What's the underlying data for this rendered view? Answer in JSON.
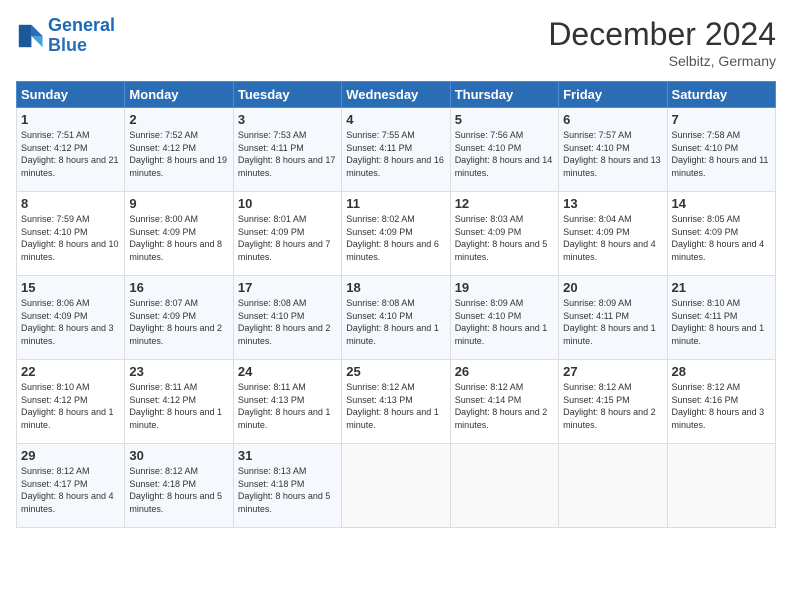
{
  "header": {
    "logo_line1": "General",
    "logo_line2": "Blue",
    "month": "December 2024",
    "location": "Selbitz, Germany"
  },
  "weekdays": [
    "Sunday",
    "Monday",
    "Tuesday",
    "Wednesday",
    "Thursday",
    "Friday",
    "Saturday"
  ],
  "weeks": [
    [
      {
        "day": "1",
        "sunrise": "Sunrise: 7:51 AM",
        "sunset": "Sunset: 4:12 PM",
        "daylight": "Daylight: 8 hours and 21 minutes."
      },
      {
        "day": "2",
        "sunrise": "Sunrise: 7:52 AM",
        "sunset": "Sunset: 4:12 PM",
        "daylight": "Daylight: 8 hours and 19 minutes."
      },
      {
        "day": "3",
        "sunrise": "Sunrise: 7:53 AM",
        "sunset": "Sunset: 4:11 PM",
        "daylight": "Daylight: 8 hours and 17 minutes."
      },
      {
        "day": "4",
        "sunrise": "Sunrise: 7:55 AM",
        "sunset": "Sunset: 4:11 PM",
        "daylight": "Daylight: 8 hours and 16 minutes."
      },
      {
        "day": "5",
        "sunrise": "Sunrise: 7:56 AM",
        "sunset": "Sunset: 4:10 PM",
        "daylight": "Daylight: 8 hours and 14 minutes."
      },
      {
        "day": "6",
        "sunrise": "Sunrise: 7:57 AM",
        "sunset": "Sunset: 4:10 PM",
        "daylight": "Daylight: 8 hours and 13 minutes."
      },
      {
        "day": "7",
        "sunrise": "Sunrise: 7:58 AM",
        "sunset": "Sunset: 4:10 PM",
        "daylight": "Daylight: 8 hours and 11 minutes."
      }
    ],
    [
      {
        "day": "8",
        "sunrise": "Sunrise: 7:59 AM",
        "sunset": "Sunset: 4:10 PM",
        "daylight": "Daylight: 8 hours and 10 minutes."
      },
      {
        "day": "9",
        "sunrise": "Sunrise: 8:00 AM",
        "sunset": "Sunset: 4:09 PM",
        "daylight": "Daylight: 8 hours and 8 minutes."
      },
      {
        "day": "10",
        "sunrise": "Sunrise: 8:01 AM",
        "sunset": "Sunset: 4:09 PM",
        "daylight": "Daylight: 8 hours and 7 minutes."
      },
      {
        "day": "11",
        "sunrise": "Sunrise: 8:02 AM",
        "sunset": "Sunset: 4:09 PM",
        "daylight": "Daylight: 8 hours and 6 minutes."
      },
      {
        "day": "12",
        "sunrise": "Sunrise: 8:03 AM",
        "sunset": "Sunset: 4:09 PM",
        "daylight": "Daylight: 8 hours and 5 minutes."
      },
      {
        "day": "13",
        "sunrise": "Sunrise: 8:04 AM",
        "sunset": "Sunset: 4:09 PM",
        "daylight": "Daylight: 8 hours and 4 minutes."
      },
      {
        "day": "14",
        "sunrise": "Sunrise: 8:05 AM",
        "sunset": "Sunset: 4:09 PM",
        "daylight": "Daylight: 8 hours and 4 minutes."
      }
    ],
    [
      {
        "day": "15",
        "sunrise": "Sunrise: 8:06 AM",
        "sunset": "Sunset: 4:09 PM",
        "daylight": "Daylight: 8 hours and 3 minutes."
      },
      {
        "day": "16",
        "sunrise": "Sunrise: 8:07 AM",
        "sunset": "Sunset: 4:09 PM",
        "daylight": "Daylight: 8 hours and 2 minutes."
      },
      {
        "day": "17",
        "sunrise": "Sunrise: 8:08 AM",
        "sunset": "Sunset: 4:10 PM",
        "daylight": "Daylight: 8 hours and 2 minutes."
      },
      {
        "day": "18",
        "sunrise": "Sunrise: 8:08 AM",
        "sunset": "Sunset: 4:10 PM",
        "daylight": "Daylight: 8 hours and 1 minute."
      },
      {
        "day": "19",
        "sunrise": "Sunrise: 8:09 AM",
        "sunset": "Sunset: 4:10 PM",
        "daylight": "Daylight: 8 hours and 1 minute."
      },
      {
        "day": "20",
        "sunrise": "Sunrise: 8:09 AM",
        "sunset": "Sunset: 4:11 PM",
        "daylight": "Daylight: 8 hours and 1 minute."
      },
      {
        "day": "21",
        "sunrise": "Sunrise: 8:10 AM",
        "sunset": "Sunset: 4:11 PM",
        "daylight": "Daylight: 8 hours and 1 minute."
      }
    ],
    [
      {
        "day": "22",
        "sunrise": "Sunrise: 8:10 AM",
        "sunset": "Sunset: 4:12 PM",
        "daylight": "Daylight: 8 hours and 1 minute."
      },
      {
        "day": "23",
        "sunrise": "Sunrise: 8:11 AM",
        "sunset": "Sunset: 4:12 PM",
        "daylight": "Daylight: 8 hours and 1 minute."
      },
      {
        "day": "24",
        "sunrise": "Sunrise: 8:11 AM",
        "sunset": "Sunset: 4:13 PM",
        "daylight": "Daylight: 8 hours and 1 minute."
      },
      {
        "day": "25",
        "sunrise": "Sunrise: 8:12 AM",
        "sunset": "Sunset: 4:13 PM",
        "daylight": "Daylight: 8 hours and 1 minute."
      },
      {
        "day": "26",
        "sunrise": "Sunrise: 8:12 AM",
        "sunset": "Sunset: 4:14 PM",
        "daylight": "Daylight: 8 hours and 2 minutes."
      },
      {
        "day": "27",
        "sunrise": "Sunrise: 8:12 AM",
        "sunset": "Sunset: 4:15 PM",
        "daylight": "Daylight: 8 hours and 2 minutes."
      },
      {
        "day": "28",
        "sunrise": "Sunrise: 8:12 AM",
        "sunset": "Sunset: 4:16 PM",
        "daylight": "Daylight: 8 hours and 3 minutes."
      }
    ],
    [
      {
        "day": "29",
        "sunrise": "Sunrise: 8:12 AM",
        "sunset": "Sunset: 4:17 PM",
        "daylight": "Daylight: 8 hours and 4 minutes."
      },
      {
        "day": "30",
        "sunrise": "Sunrise: 8:12 AM",
        "sunset": "Sunset: 4:18 PM",
        "daylight": "Daylight: 8 hours and 5 minutes."
      },
      {
        "day": "31",
        "sunrise": "Sunrise: 8:13 AM",
        "sunset": "Sunset: 4:18 PM",
        "daylight": "Daylight: 8 hours and 5 minutes."
      },
      null,
      null,
      null,
      null
    ]
  ]
}
